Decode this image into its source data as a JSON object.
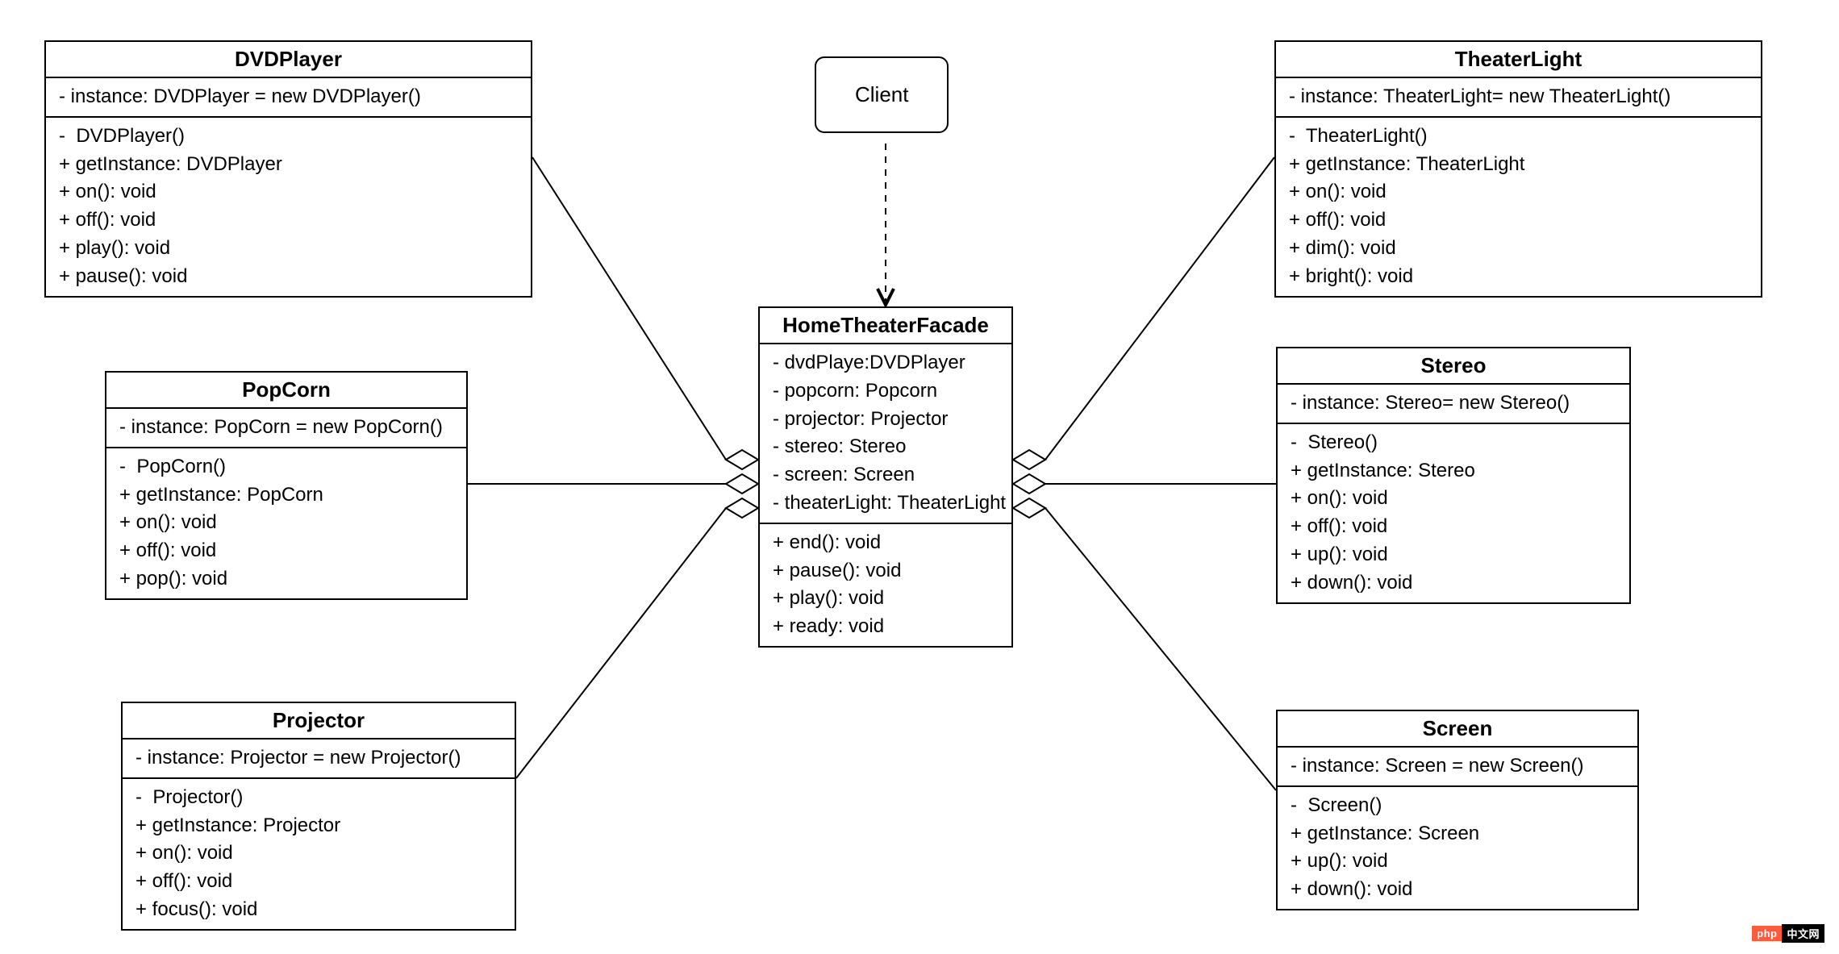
{
  "client": {
    "label": "Client"
  },
  "facade": {
    "name": "HomeTheaterFacade",
    "fields": [
      "- dvdPlaye:DVDPlayer",
      "- popcorn: Popcorn",
      "- projector: Projector",
      "- stereo: Stereo",
      "- screen: Screen",
      "- theaterLight: TheaterLight"
    ],
    "methods": [
      "+ end(): void",
      "+ pause(): void",
      "+ play(): void",
      "+ ready: void"
    ]
  },
  "dvdplayer": {
    "name": "DVDPlayer",
    "fields": [
      "- instance: DVDPlayer = new DVDPlayer()"
    ],
    "methods": [
      "-  DVDPlayer()",
      "+ getInstance: DVDPlayer",
      "+ on(): void",
      "+ off(): void",
      "+ play(): void",
      "+ pause(): void"
    ]
  },
  "popcorn": {
    "name": "PopCorn",
    "fields": [
      "- instance: PopCorn = new PopCorn()"
    ],
    "methods": [
      "-  PopCorn()",
      "+ getInstance: PopCorn",
      "+ on(): void",
      "+ off(): void",
      "+ pop(): void"
    ]
  },
  "projector": {
    "name": "Projector",
    "fields": [
      "- instance: Projector = new Projector()"
    ],
    "methods": [
      "-  Projector()",
      "+ getInstance: Projector",
      "+ on(): void",
      "+ off(): void",
      "+ focus(): void"
    ]
  },
  "theaterlight": {
    "name": "TheaterLight",
    "fields": [
      "- instance: TheaterLight= new TheaterLight()"
    ],
    "methods": [
      "-  TheaterLight()",
      "+ getInstance: TheaterLight",
      "+ on(): void",
      "+ off(): void",
      "+ dim(): void",
      "+ bright(): void"
    ]
  },
  "stereo": {
    "name": "Stereo",
    "fields": [
      "- instance: Stereo= new Stereo()"
    ],
    "methods": [
      "-  Stereo()",
      "+ getInstance: Stereo",
      "+ on(): void",
      "+ off(): void",
      "+ up(): void",
      "+ down(): void"
    ]
  },
  "screen": {
    "name": "Screen",
    "fields": [
      "- instance: Screen = new Screen()"
    ],
    "methods": [
      "-  Screen()",
      "+ getInstance: Screen",
      "+ up(): void",
      "+ down(): void"
    ]
  },
  "watermark": {
    "left": "php",
    "right": "中文网"
  },
  "chart_data": {
    "type": "uml_class_diagram",
    "nodes": [
      {
        "id": "Client",
        "kind": "actor"
      },
      {
        "id": "HomeTheaterFacade",
        "kind": "class",
        "fields": [
          "dvdPlaye:DVDPlayer",
          "popcorn: Popcorn",
          "projector: Projector",
          "stereo: Stereo",
          "screen: Screen",
          "theaterLight: TheaterLight"
        ],
        "methods": [
          "end(): void",
          "pause(): void",
          "play(): void",
          "ready: void"
        ]
      },
      {
        "id": "DVDPlayer",
        "kind": "class",
        "fields": [
          "instance: DVDPlayer = new DVDPlayer()"
        ],
        "methods": [
          "DVDPlayer()",
          "getInstance: DVDPlayer",
          "on(): void",
          "off(): void",
          "play(): void",
          "pause(): void"
        ]
      },
      {
        "id": "PopCorn",
        "kind": "class",
        "fields": [
          "instance: PopCorn = new PopCorn()"
        ],
        "methods": [
          "PopCorn()",
          "getInstance: PopCorn",
          "on(): void",
          "off(): void",
          "pop(): void"
        ]
      },
      {
        "id": "Projector",
        "kind": "class",
        "fields": [
          "instance: Projector = new Projector()"
        ],
        "methods": [
          "Projector()",
          "getInstance: Projector",
          "on(): void",
          "off(): void",
          "focus(): void"
        ]
      },
      {
        "id": "TheaterLight",
        "kind": "class",
        "fields": [
          "instance: TheaterLight= new TheaterLight()"
        ],
        "methods": [
          "TheaterLight()",
          "getInstance: TheaterLight",
          "on(): void",
          "off(): void",
          "dim(): void",
          "bright(): void"
        ]
      },
      {
        "id": "Stereo",
        "kind": "class",
        "fields": [
          "instance: Stereo= new Stereo()"
        ],
        "methods": [
          "Stereo()",
          "getInstance: Stereo",
          "on(): void",
          "off(): void",
          "up(): void",
          "down(): void"
        ]
      },
      {
        "id": "Screen",
        "kind": "class",
        "fields": [
          "instance: Screen = new Screen()"
        ],
        "methods": [
          "Screen()",
          "getInstance: Screen",
          "up(): void",
          "down(): void"
        ]
      }
    ],
    "edges": [
      {
        "from": "Client",
        "to": "HomeTheaterFacade",
        "type": "dependency"
      },
      {
        "from": "HomeTheaterFacade",
        "to": "DVDPlayer",
        "type": "aggregation"
      },
      {
        "from": "HomeTheaterFacade",
        "to": "PopCorn",
        "type": "aggregation"
      },
      {
        "from": "HomeTheaterFacade",
        "to": "Projector",
        "type": "aggregation"
      },
      {
        "from": "HomeTheaterFacade",
        "to": "TheaterLight",
        "type": "aggregation"
      },
      {
        "from": "HomeTheaterFacade",
        "to": "Stereo",
        "type": "aggregation"
      },
      {
        "from": "HomeTheaterFacade",
        "to": "Screen",
        "type": "aggregation"
      }
    ]
  }
}
